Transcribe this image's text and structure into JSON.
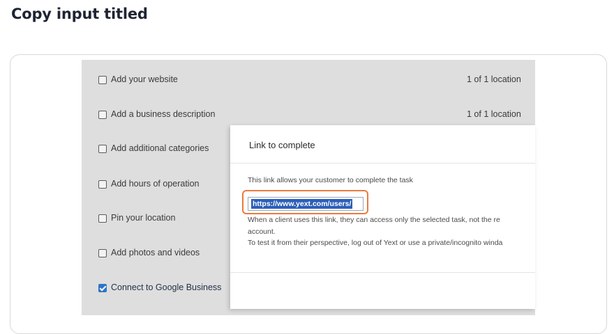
{
  "page": {
    "heading": "Copy input titled"
  },
  "tasks": [
    {
      "label": "Add your website",
      "status": "1 of 1 location",
      "checked": false
    },
    {
      "label": "Add a business description",
      "status": "1 of 1 location",
      "checked": false
    },
    {
      "label": "Add additional categories",
      "status": "",
      "checked": false
    },
    {
      "label": "Add hours of operation",
      "status": "",
      "checked": false
    },
    {
      "label": "Pin your location",
      "status": "",
      "checked": false
    },
    {
      "label": "Add photos and videos",
      "status": "",
      "checked": false
    },
    {
      "label": "Connect to Google Business",
      "status": "",
      "checked": true
    }
  ],
  "modal": {
    "title": "Link to complete",
    "description": "This link allows your customer to complete the task",
    "link_value": "https://www.yext.com/users/",
    "note_line1": "When a client uses this link, they can access only the selected task, not the re",
    "note_line2": "account.",
    "note_line3": "To test it from their perspective, log out of Yext or use a private/incognito winda"
  },
  "colors": {
    "highlight": "#ec7a3c",
    "selection": "#2c5fb8",
    "checkbox_checked": "#2f73c9"
  }
}
